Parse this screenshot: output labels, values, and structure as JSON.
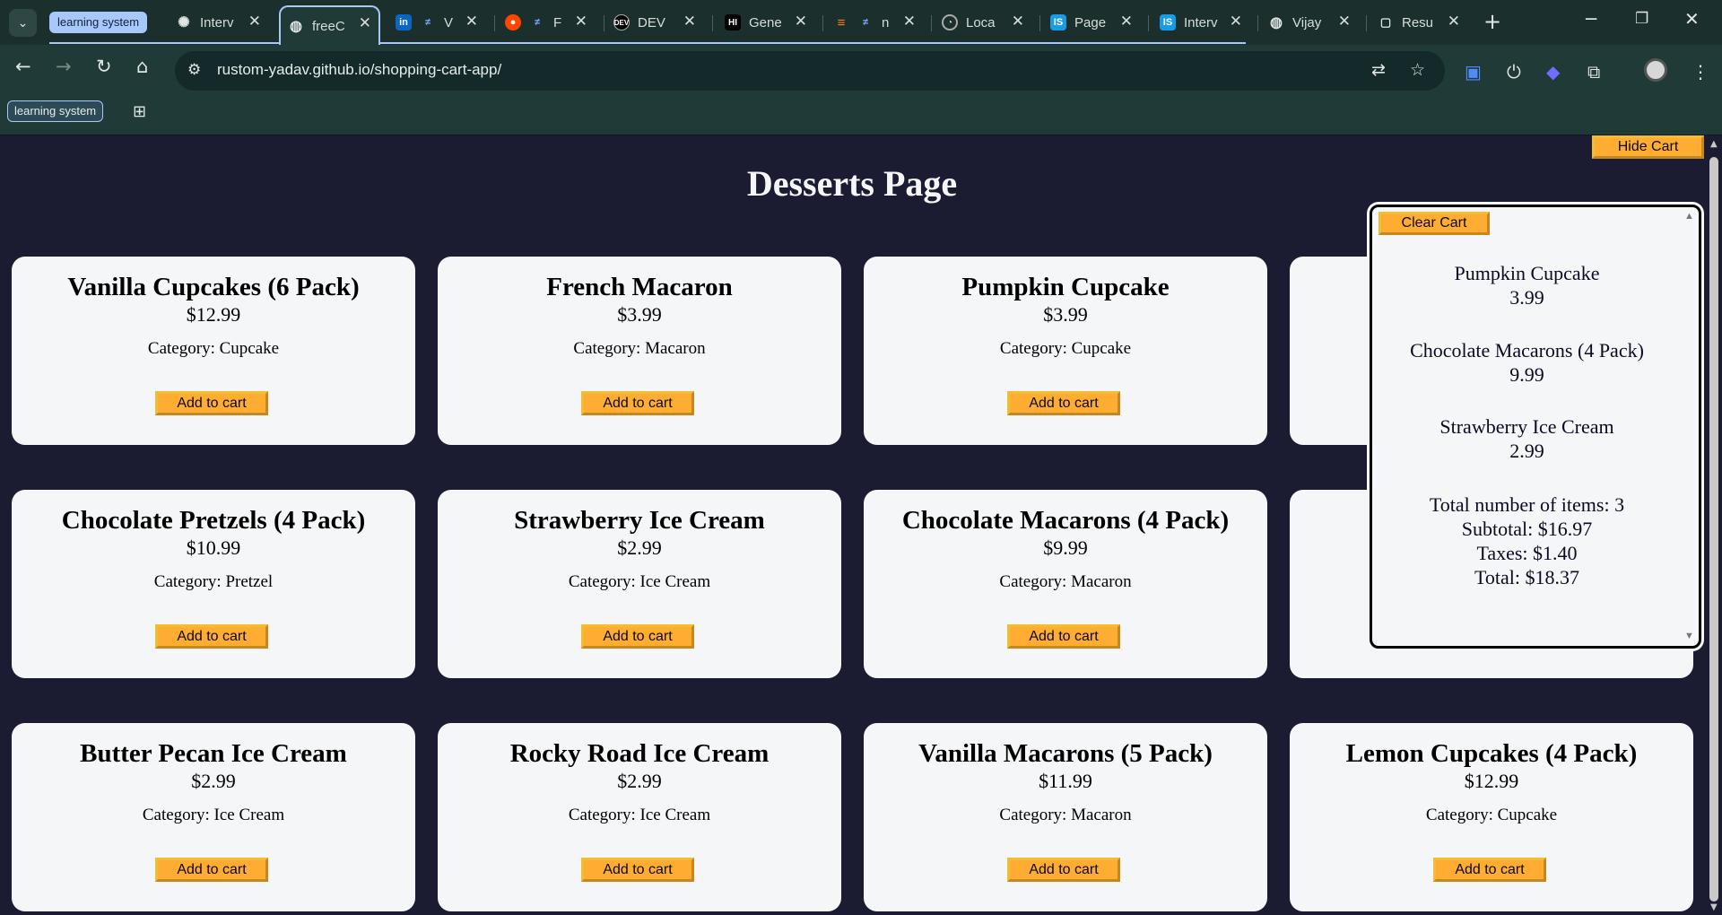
{
  "browser": {
    "tab_group_label": "learning system",
    "tabs": [
      {
        "title": "Interv",
        "icon": "openai-icon",
        "active": false
      },
      {
        "title": "freeC",
        "icon": "globe-icon",
        "active": true
      },
      {
        "title": "V",
        "icon": "linkedin-icon",
        "active": false
      },
      {
        "title": "F",
        "icon": "reddit-icon",
        "active": false
      },
      {
        "title": "DEV",
        "icon": "dev-icon",
        "active": false
      },
      {
        "title": "Gene",
        "icon": "gfg-icon",
        "active": false
      },
      {
        "title": "n",
        "icon": "stackoverflow-icon",
        "active": false
      },
      {
        "title": "Loca",
        "icon": "leetcode-icon",
        "active": false
      },
      {
        "title": "Page",
        "icon": "is-icon",
        "active": false
      },
      {
        "title": "Interv",
        "icon": "is-icon",
        "active": false
      },
      {
        "title": "Vijay",
        "icon": "globe-icon",
        "active": false
      },
      {
        "title": "Resu",
        "icon": "doc-icon",
        "active": false
      }
    ],
    "url": "rustom-yadav.github.io/shopping-cart-app/",
    "bookmark_group_label": "learning system"
  },
  "page": {
    "title": "Desserts Page",
    "add_label": "Add to cart",
    "hide_cart_label": "Hide Cart",
    "products": [
      {
        "name": "Vanilla Cupcakes (6 Pack)",
        "price": "$12.99",
        "category": "Category: Cupcake"
      },
      {
        "name": "French Macaron",
        "price": "$3.99",
        "category": "Category: Macaron"
      },
      {
        "name": "Pumpkin Cupcake",
        "price": "$3.99",
        "category": "Category: Cupcake"
      },
      {
        "name": "",
        "price": "",
        "category": ""
      },
      {
        "name": "Chocolate Pretzels (4 Pack)",
        "price": "$10.99",
        "category": "Category: Pretzel"
      },
      {
        "name": "Strawberry Ice Cream",
        "price": "$2.99",
        "category": "Category: Ice Cream"
      },
      {
        "name": "Chocolate Macarons (4 Pack)",
        "price": "$9.99",
        "category": "Category: Macaron"
      },
      {
        "name": "",
        "price": "",
        "category": ""
      },
      {
        "name": "Butter Pecan Ice Cream",
        "price": "$2.99",
        "category": "Category: Ice Cream"
      },
      {
        "name": "Rocky Road Ice Cream",
        "price": "$2.99",
        "category": "Category: Ice Cream"
      },
      {
        "name": "Vanilla Macarons (5 Pack)",
        "price": "$11.99",
        "category": "Category: Macaron"
      },
      {
        "name": "Lemon Cupcakes (4 Pack)",
        "price": "$12.99",
        "category": "Category: Cupcake"
      }
    ]
  },
  "cart": {
    "clear_label": "Clear Cart",
    "items": [
      {
        "name": "Pumpkin Cupcake",
        "price": "3.99"
      },
      {
        "name": "Chocolate Macarons (4 Pack)",
        "price": "9.99"
      },
      {
        "name": "Strawberry Ice Cream",
        "price": "2.99"
      }
    ],
    "total_items": "Total number of items: 3",
    "subtotal": "Subtotal: $16.97",
    "taxes": "Taxes: $1.40",
    "total": "Total: $18.37"
  },
  "colors": {
    "page_bg": "#1b1b32",
    "card_bg": "#f5f6f7",
    "button_bg": "#feac32",
    "chrome_bg": "#1f3a37"
  }
}
